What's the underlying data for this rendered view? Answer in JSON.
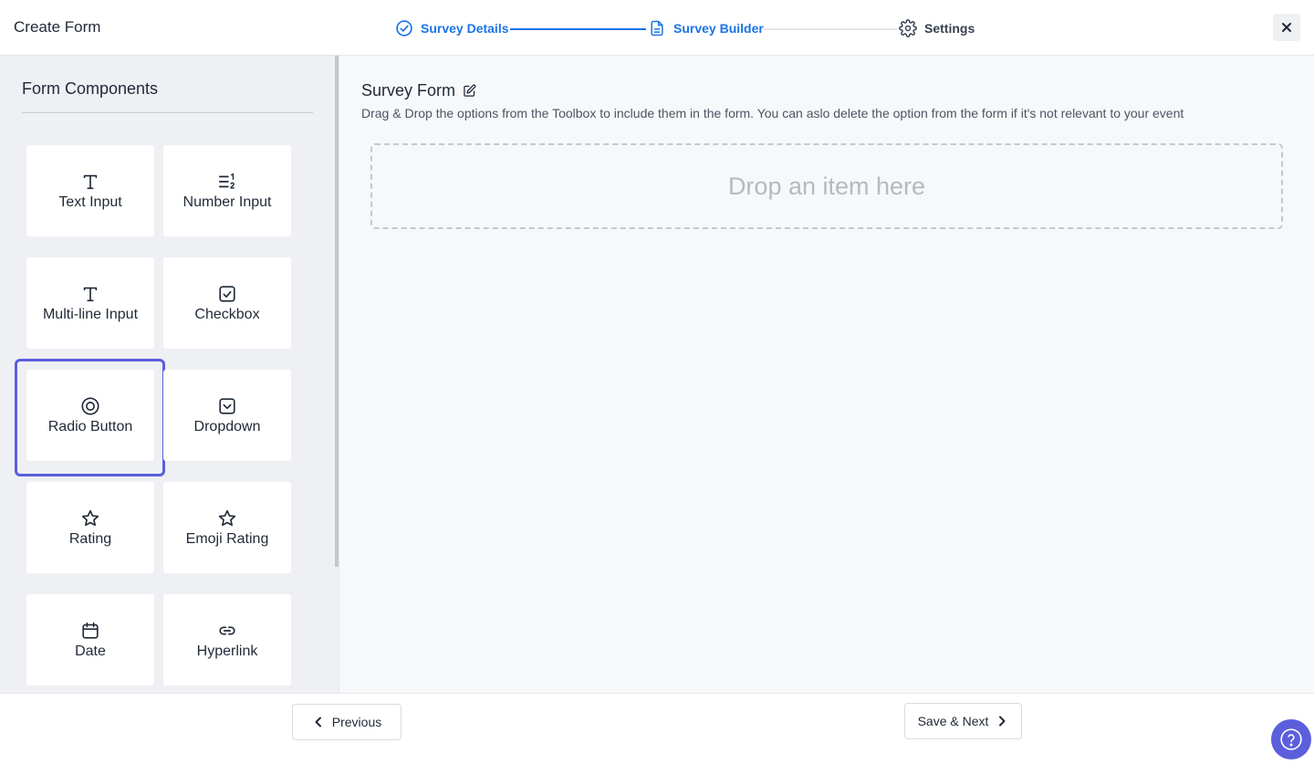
{
  "header": {
    "title": "Create Form",
    "steps": [
      {
        "label": "Survey Details",
        "icon": "check-circle-icon",
        "state": "completed"
      },
      {
        "label": "Survey Builder",
        "icon": "document-icon",
        "state": "active"
      },
      {
        "label": "Settings",
        "icon": "gear-icon",
        "state": "pending"
      }
    ],
    "close_icon": "close-icon"
  },
  "sidebar": {
    "title": "Form Components",
    "components": [
      {
        "label": "Text Input",
        "icon": "text-t-icon"
      },
      {
        "label": "Number Input",
        "icon": "number-list-icon"
      },
      {
        "label": "Multi-line Input",
        "icon": "text-t-icon"
      },
      {
        "label": "Checkbox",
        "icon": "checkbox-icon"
      },
      {
        "label": "Radio Button",
        "icon": "radio-icon",
        "selected": true
      },
      {
        "label": "Dropdown",
        "icon": "dropdown-icon"
      },
      {
        "label": "Rating",
        "icon": "star-icon"
      },
      {
        "label": "Emoji Rating",
        "icon": "star-icon"
      },
      {
        "label": "Date",
        "icon": "calendar-icon"
      },
      {
        "label": "Hyperlink",
        "icon": "link-icon"
      }
    ]
  },
  "main": {
    "form_title": "Survey Form",
    "description": "Drag & Drop the options from the Toolbox to include them in the form. You can aslo delete the option from the form if it's not relevant to your event",
    "drop_zone_text": "Drop an item here"
  },
  "footer": {
    "previous_label": "Previous",
    "next_label": "Save & Next"
  },
  "colors": {
    "accent_blue": "#1a73e8",
    "selection_purple": "#5b5fdc",
    "sidebar_bg": "#eef0f4",
    "main_bg": "#f7f8fa"
  }
}
